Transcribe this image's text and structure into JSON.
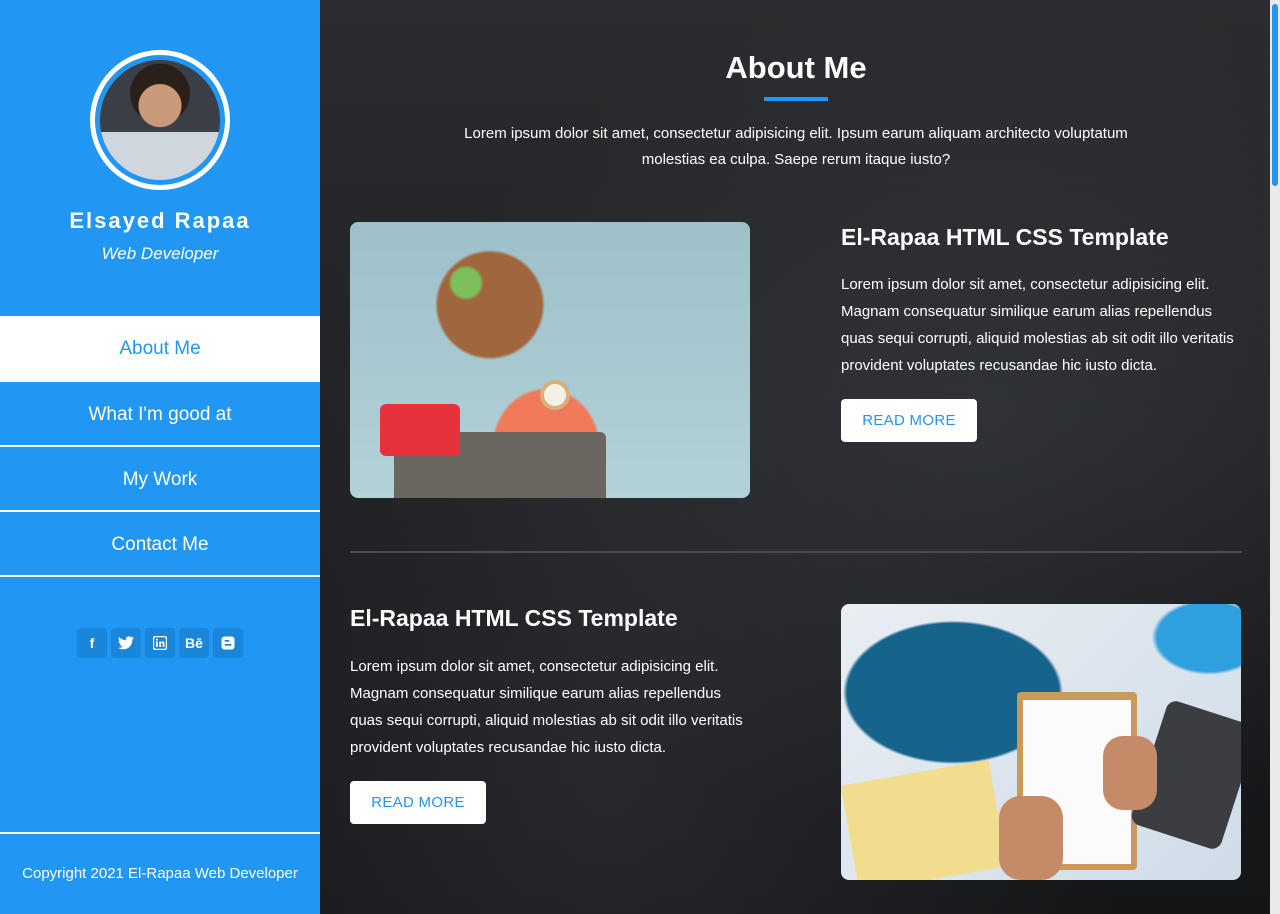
{
  "profile": {
    "name": "Elsayed Rapaa",
    "role": "Web Developer"
  },
  "nav": {
    "items": [
      {
        "label": "About Me",
        "active": true
      },
      {
        "label": "What I'm good at",
        "active": false
      },
      {
        "label": "My Work",
        "active": false
      },
      {
        "label": "Contact Me",
        "active": false
      }
    ]
  },
  "social": {
    "icons": [
      {
        "name": "facebook-icon",
        "glyph": "f"
      },
      {
        "name": "twitter-icon",
        "glyph": "t"
      },
      {
        "name": "linkedin-icon",
        "glyph": "in"
      },
      {
        "name": "behance-icon",
        "glyph": "Bē"
      },
      {
        "name": "blogger-icon",
        "glyph": "b"
      }
    ]
  },
  "footer": {
    "copyright": "Copyright 2021 El-Rapaa Web Developer"
  },
  "about": {
    "title": "About Me",
    "intro": "Lorem ipsum dolor sit amet, consectetur adipisicing elit. Ipsum earum aliquam architecto voluptatum molestias ea culpa. Saepe rerum itaque iusto?"
  },
  "cards": [
    {
      "title": "El-Rapaa HTML CSS Template",
      "text": "Lorem ipsum dolor sit amet, consectetur adipisicing elit. Magnam consequatur similique earum alias repellendus quas sequi corrupti, aliquid molestias ab sit odit illo veritatis provident voluptates recusandae hic iusto dicta.",
      "button": "READ MORE"
    },
    {
      "title": "El-Rapaa HTML CSS Template",
      "text": "Lorem ipsum dolor sit amet, consectetur adipisicing elit. Magnam consequatur similique earum alias repellendus quas sequi corrupti, aliquid molestias ab sit odit illo veritatis provident voluptates recusandae hic iusto dicta.",
      "button": "READ MORE"
    }
  ],
  "colors": {
    "accent": "#2196f3",
    "background": "#1e1f22",
    "text": "#ffffff"
  }
}
